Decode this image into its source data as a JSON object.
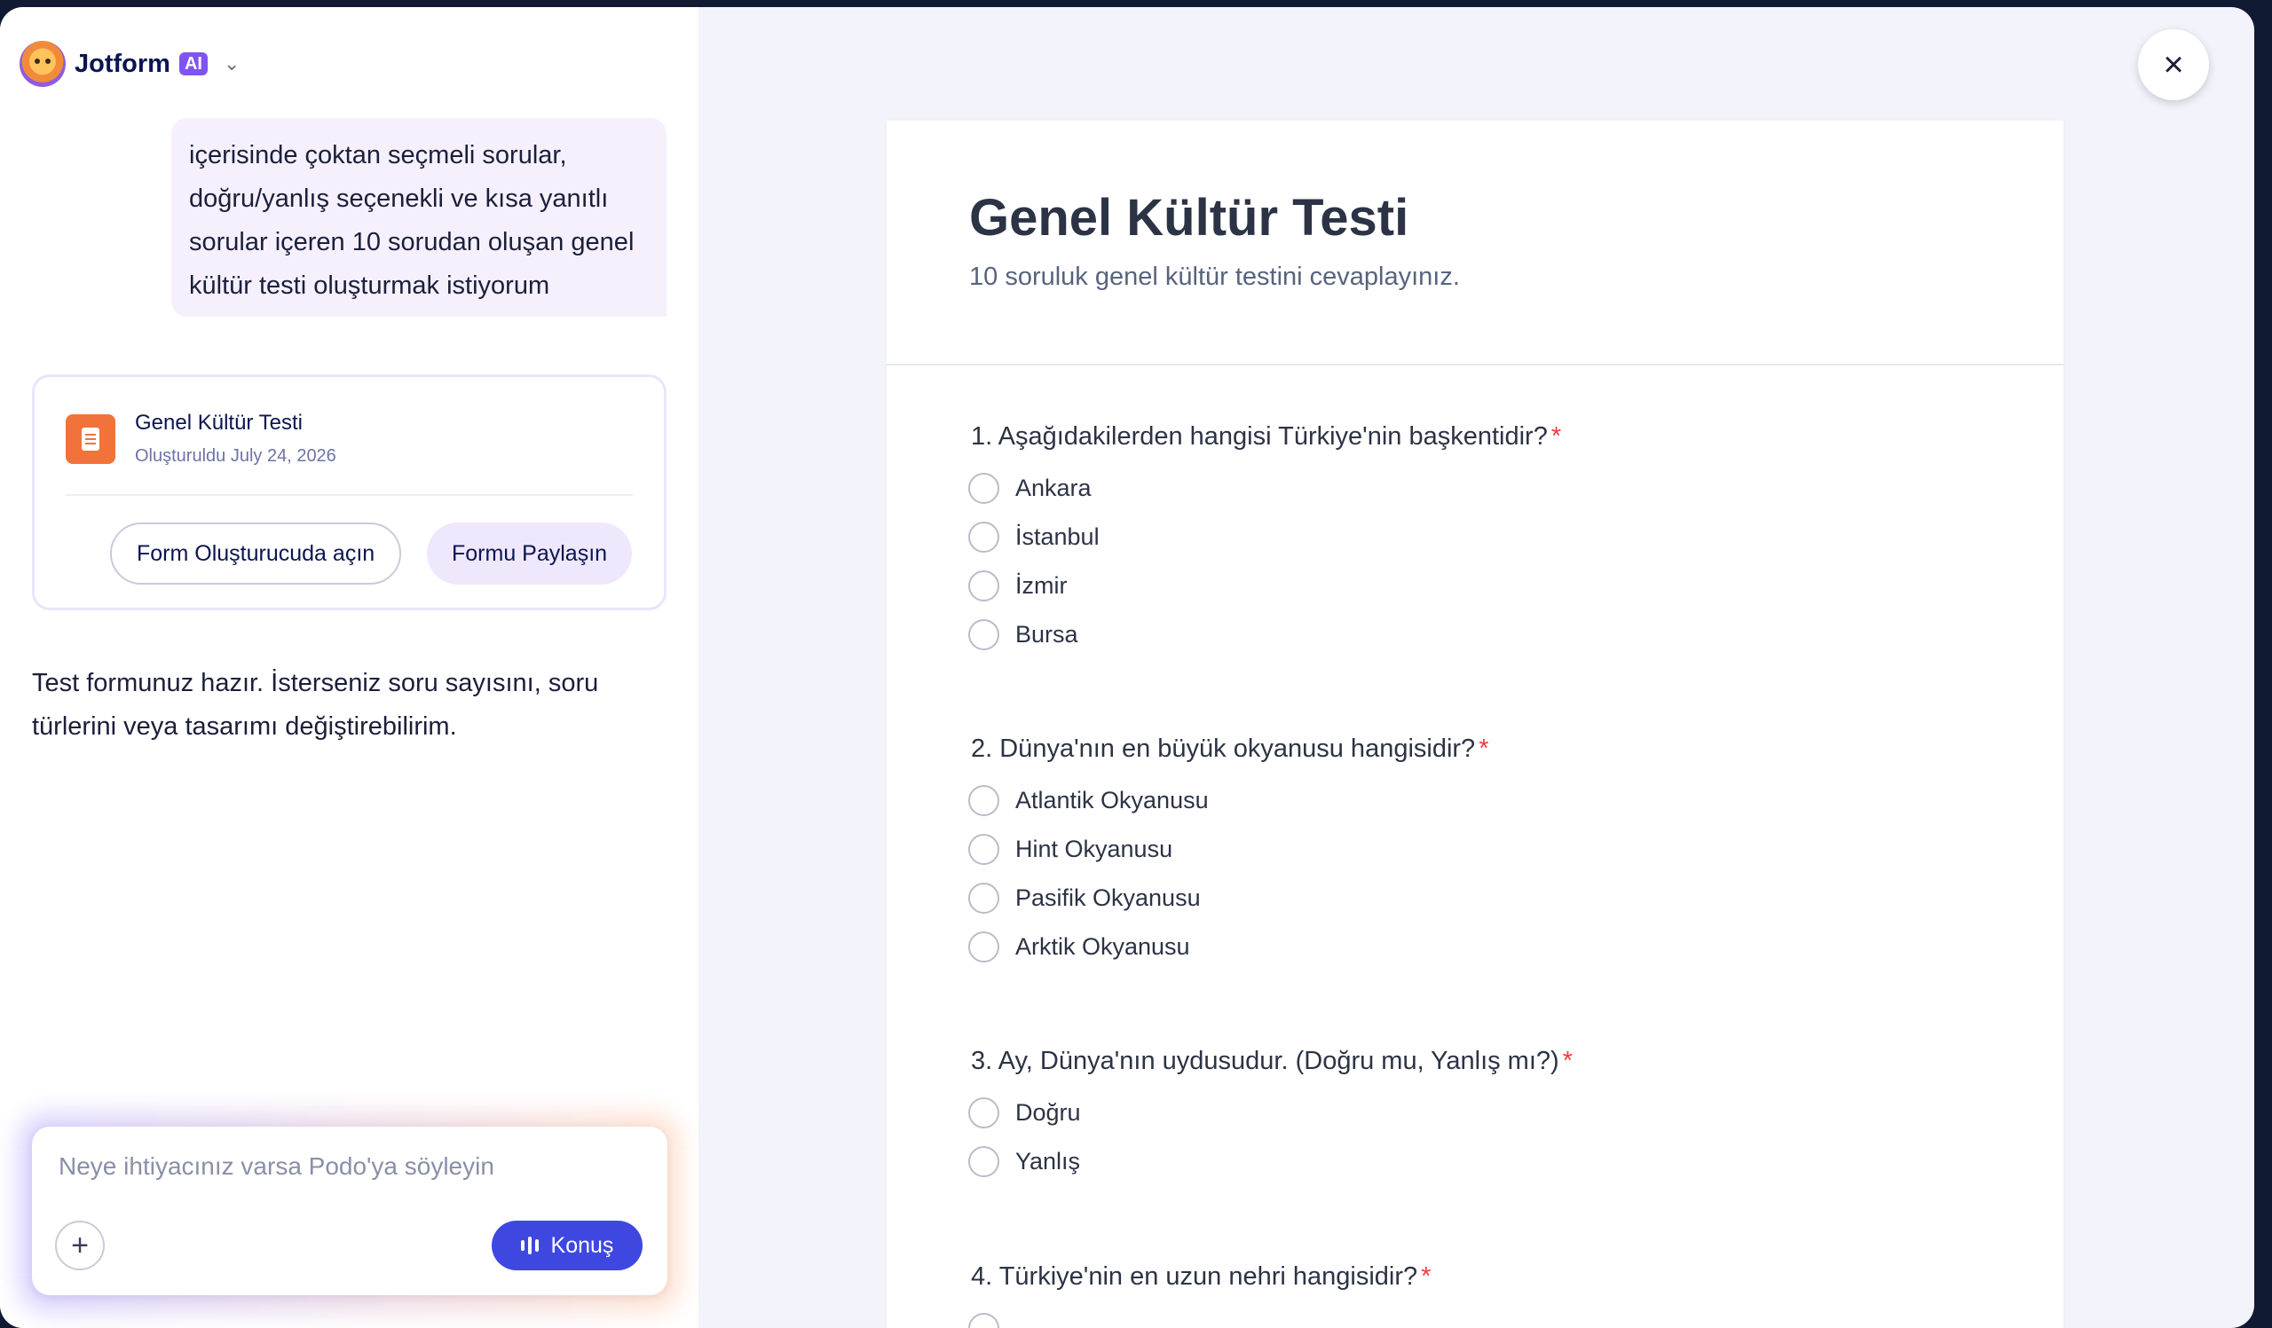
{
  "brand": {
    "name": "Jotform",
    "badge": "AI"
  },
  "chat": {
    "user_message": "içerisinde çoktan seçmeli sorular, doğru/yanlış seçenekli ve kısa yanıtlı sorular içeren 10 sorudan oluşan genel kültür testi oluşturmak istiyorum",
    "form_card": {
      "title": "Genel Kültür Testi",
      "created": "Oluşturuldu July 24, 2026",
      "open_builder_label": "Form Oluşturucuda açın",
      "share_label": "Formu Paylaşın"
    },
    "assistant_message": "Test formunuz hazır. İsterseniz soru sayısını, soru türlerini veya tasarımı değiştirebilirim.",
    "composer": {
      "placeholder": "Neye ihtiyacınız varsa Podo'ya söyleyin",
      "talk_label": "Konuş"
    }
  },
  "form": {
    "title": "Genel Kültür Testi",
    "subtitle": "10 soruluk genel kültür testini cevaplayınız.",
    "questions": [
      {
        "label": "1. Aşağıdakilerden hangisi Türkiye'nin başkentidir?",
        "required": "*",
        "options": [
          "Ankara",
          "İstanbul",
          "İzmir",
          "Bursa"
        ]
      },
      {
        "label": "2. Dünya'nın en büyük okyanusu hangisidir?",
        "required": "*",
        "options": [
          "Atlantik Okyanusu",
          "Hint Okyanusu",
          "Pasifik Okyanusu",
          "Arktik Okyanusu"
        ]
      },
      {
        "label": "3. Ay, Dünya'nın uydusudur. (Doğru mu, Yanlış mı?)",
        "required": "*",
        "options": [
          "Doğru",
          "Yanlış"
        ]
      },
      {
        "label": "4. Türkiye'nin en uzun nehri hangisidir?",
        "required": "*"
      }
    ]
  },
  "close_icon": "×",
  "colors": {
    "accent": "#3e48e0",
    "brand_badge": "#7f54f2",
    "form_icon": "#f2733a",
    "required": "#f23a3c"
  }
}
